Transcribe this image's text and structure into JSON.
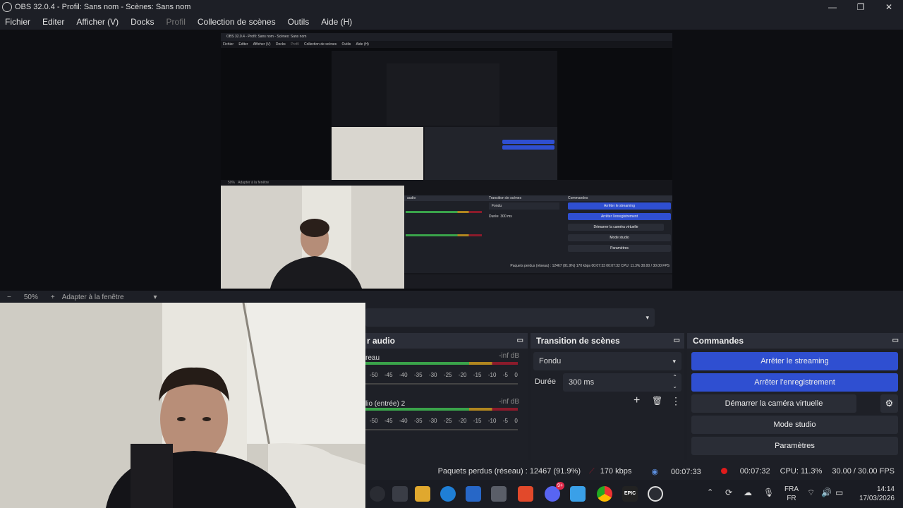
{
  "window": {
    "title": "OBS 32.0.4 - Profil: Sans nom - Scènes: Sans nom",
    "minimize": "—",
    "maximize": "❐",
    "close": "✕"
  },
  "menu": {
    "items": [
      "Fichier",
      "Editer",
      "Afficher (V)",
      "Docks",
      "Profil",
      "Collection de scènes",
      "Outils",
      "Aide (H)"
    ]
  },
  "inner_window": {
    "title": "OBS 32.0.4 - Profil: Sans nom - Scènes: Sans nom",
    "menu": [
      "Fichier",
      "Editer",
      "Afficher (V)",
      "Docks",
      "Profil",
      "Collection de scènes",
      "Outils",
      "Aide (H)"
    ],
    "zoom_label": "50%",
    "fit_label": "Adapter à la fenêtre",
    "btn_stop_stream": "Arrêter le streaming",
    "btn_stop_rec": "Arrêter l'enregistrement",
    "btn_vcam": "Démarrer la caméra virtuelle",
    "btn_studio": "Mode studio",
    "btn_settings": "Paramètres",
    "transition_header": "Transition de scènes",
    "controls_header": "Commandes",
    "audio_header": "audio",
    "fade": "Fondu",
    "duration_label": "Durée",
    "duration_value": "300 ms",
    "status": "Paquets perdus (réseau) : 12467 (91.9%)   170 kbps   00:07:33   00:07:32   CPU: 11.3%   30.00 / 30.00 FPS"
  },
  "zoombar": {
    "minus": "−",
    "zoom": "50%",
    "plus": "+",
    "fit": "Adapter à la fenêtre",
    "dropdown": "▾"
  },
  "scene_select": {
    "arrow": "▾"
  },
  "mixer": {
    "header": "r audio",
    "tracks": [
      {
        "label": "reau",
        "db": "-inf dB"
      },
      {
        "label": "lio (entrée) 2",
        "db": "-inf dB"
      }
    ],
    "scale": [
      "-50",
      "-45",
      "-40",
      "-35",
      "-30",
      "-25",
      "-20",
      "-15",
      "-10",
      "-5",
      "0"
    ]
  },
  "transitions": {
    "header": "Transition de scènes",
    "type": "Fondu",
    "duration_label": "Durée",
    "duration_value": "300 ms",
    "add": "+",
    "remove": "🗑",
    "more": "⋮"
  },
  "controls": {
    "header": "Commandes",
    "stop_streaming": "Arrêter le streaming",
    "stop_recording": "Arrêter l'enregistrement",
    "virtual_cam": "Démarrer la caméra virtuelle",
    "studio_mode": "Mode studio",
    "settings": "Paramètres",
    "gear": "⚙",
    "accent": "#2f4fd1"
  },
  "status": {
    "dropped": "Paquets perdus (réseau) : 12467 (91.9%)",
    "bitrate": "170 kbps",
    "stream_time": "00:07:33",
    "rec_time": "00:07:32",
    "cpu": "CPU: 11.3%",
    "fps": "30.00 / 30.00 FPS"
  },
  "taskbar": {
    "lang_top": "FRA",
    "lang_bottom": "FR",
    "time": "14:14",
    "date": "17/03/2026",
    "discord_badge": "9+",
    "epic": "EPIC"
  }
}
